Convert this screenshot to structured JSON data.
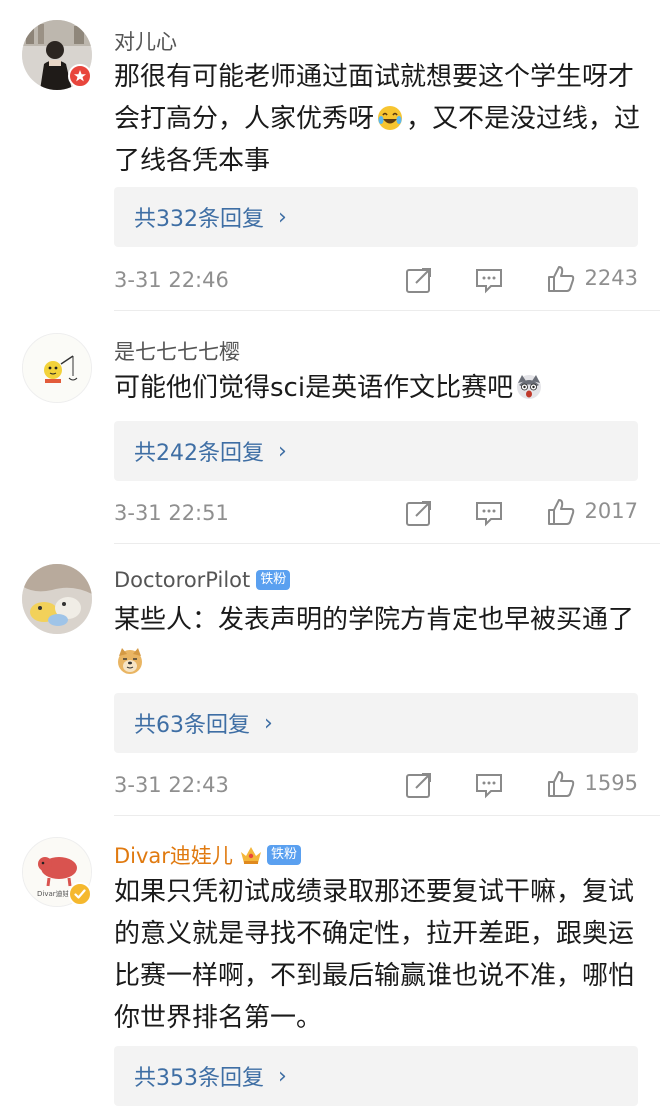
{
  "comments": [
    {
      "username": "对儿心",
      "text": "那很有可能老师通过面试就想要这个学生呀才会打高分，人家优秀呀😂，又不是没过线，过了线各凭本事",
      "text_before_emoji": "那很有可能老师通过面试就想要这个学生呀才会打高分，人家优秀呀",
      "text_after_emoji": "，又不是没过线，过了线各凭本事",
      "emoji": "laughing-tears-emoji",
      "replies_label": "共332条回复",
      "time": "3-31 22:46",
      "likes": "2243"
    },
    {
      "username": "是七七七七樱",
      "text": "可能他们觉得sci是英语作文比赛吧",
      "text_before_emoji": "可能他们觉得sci是英语作文比赛吧",
      "text_after_emoji": "",
      "emoji": "shocked-husky-emoji",
      "replies_label": "共242条回复",
      "time": "3-31 22:51",
      "likes": "2017"
    },
    {
      "username": "DoctororPilot",
      "badge": "铁粉",
      "text": "某些人：发表声明的学院方肯定也早被买通了",
      "text_before_emoji": "某些人：发表声明的学院方肯定也早被买通了",
      "text_after_emoji": "",
      "emoji": "doge-emoji",
      "replies_label": "共63条回复",
      "time": "3-31 22:43",
      "likes": "1595"
    },
    {
      "username": "Divar迪娃儿",
      "badge": "铁粉",
      "avatar_caption": "Divar迪娃儿",
      "text": "如果只凭初试成绩录取那还要复试干嘛，复试的意义就是寻找不确定性，拉开差距，跟奥运比赛一样啊，不到最后输赢谁也说不准，哪怕你世界排名第一。",
      "replies_label": "共353条回复"
    }
  ],
  "colors": {
    "reply_link": "#3e6ea4",
    "reply_bg": "#f3f3f3",
    "meta_text": "#8f8f8f",
    "vip_name": "#e07a10",
    "fan_badge": "#5aa0f0"
  }
}
